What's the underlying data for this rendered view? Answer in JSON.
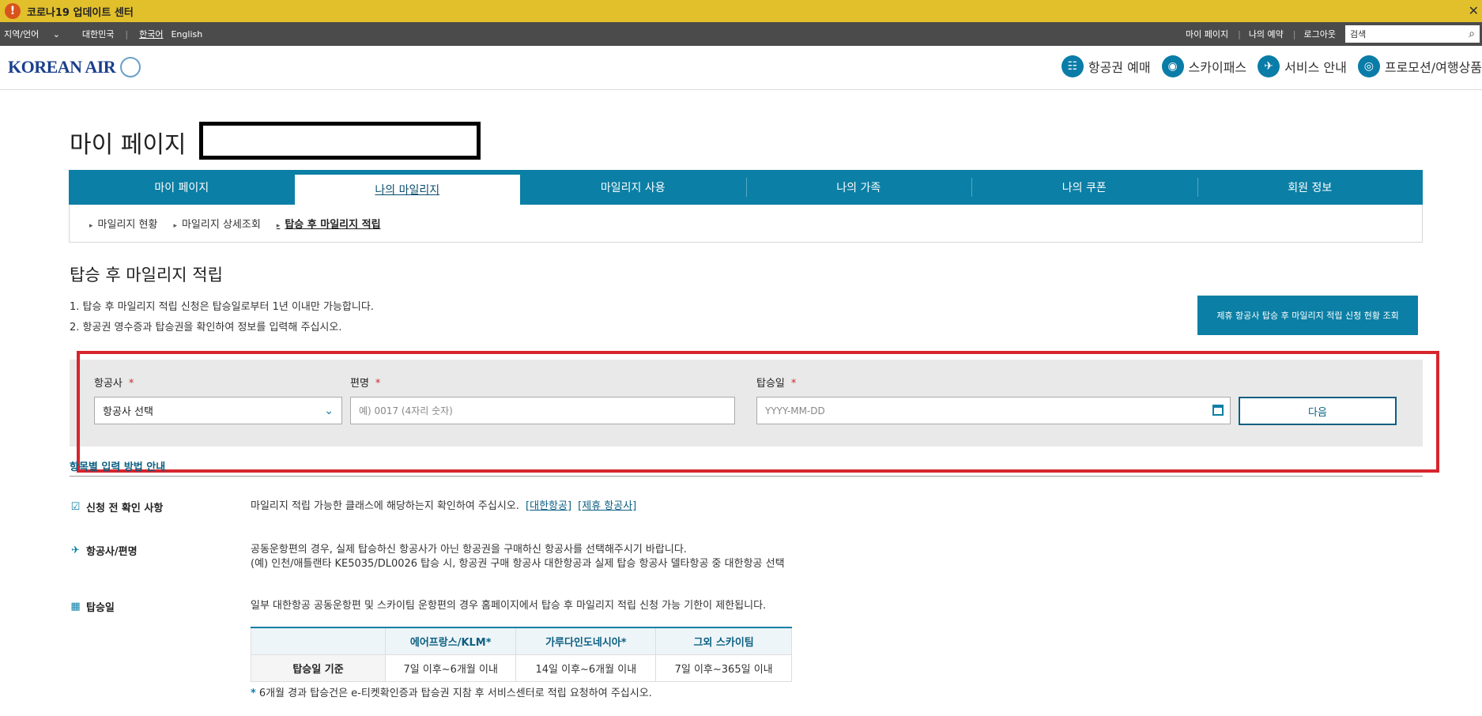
{
  "covid": {
    "icon": "!",
    "text": "코로나19 업데이트 센터",
    "close": "✕"
  },
  "util": {
    "region_lang": "지역/언어",
    "region_chevron": "⌄",
    "country": "대한민국",
    "sep": "|",
    "lang_ko": "한국어",
    "lang_en": "English",
    "my_page": "마이 페이지",
    "my_booking": "나의 예약",
    "logout": "로그아웃",
    "search_placeholder": "검색",
    "search_icon": "⌕"
  },
  "header": {
    "logo": "KOREAN AIR",
    "nav": [
      {
        "label": "항공권 예매",
        "icon": "☷"
      },
      {
        "label": "스카이패스",
        "icon": "◉"
      },
      {
        "label": "서비스 안내",
        "icon": "✈"
      },
      {
        "label": "프로모션/여행상품",
        "icon": "◎"
      }
    ]
  },
  "page": {
    "title": "마이 페이지"
  },
  "tabs": [
    {
      "label": "마이 페이지"
    },
    {
      "label": "나의 마일리지"
    },
    {
      "label": "마일리지 사용"
    },
    {
      "label": "나의 가족"
    },
    {
      "label": "나의 쿠폰"
    },
    {
      "label": "회원 정보"
    }
  ],
  "subtabs": [
    {
      "label": "마일리지 현황"
    },
    {
      "label": "마일리지 상세조회"
    },
    {
      "label": "탑승 후 마일리지 적립"
    }
  ],
  "section": {
    "title": "탑승 후 마일리지 적립",
    "notes": [
      "1.  탑승 후 마일리지 적립 신청은 탑승일로부터 1년 이내만 가능합니다.",
      "2.  항공권 영수증과 탑승권을 확인하여 정보를 입력해 주십시오."
    ],
    "status_button": "제휴 항공사 탑승 후 마일리지 적립 신청 현황 조회"
  },
  "form": {
    "airline_label": "항공사",
    "flight_label": "편명",
    "date_label": "탑승일",
    "required_mark": "*",
    "airline_value": "항공사 선택",
    "airline_chevron": "⌄",
    "flight_placeholder": "예) 0017 (4자리 숫자)",
    "date_placeholder": "YYYY-MM-DD",
    "next_button": "다음",
    "guide_link": "항목별 입력 방법 안내"
  },
  "info": {
    "check": {
      "title": "신청 전 확인 사항",
      "icon": "☑",
      "text": "마일리지 적립 가능한 클래스에 해당하는지 확인하여 주십시오.",
      "link1": "[대한항공]",
      "link2": "[제휴 항공사]"
    },
    "airline": {
      "title": "항공사/편명",
      "icon": "✈",
      "line1": "공동운항편의 경우, 실제 탑승하신 항공사가 아닌 항공권을 구매하신 항공사를 선택해주시기 바랍니다.",
      "line2": "(예) 인천/애틀랜타 KE5035/DL0026 탑승 시, 항공권 구매 항공사 대한항공과 실제 탑승 항공사 델타항공 중 대한항공 선택"
    },
    "date": {
      "title": "탑승일",
      "icon": "▦",
      "text": "일부 대한항공 공동운항편 및 스카이팀 운항편의 경우 홈페이지에서 탑승 후 마일리지 적립 신청 가능 기한이 제한됩니다."
    }
  },
  "table": {
    "headers": [
      "에어프랑스/KLM*",
      "가루다인도네시아*",
      "그외 스카이팀"
    ],
    "row_header": "탑승일 기준",
    "cells": [
      "7일 이후~6개월 이내",
      "14일 이후~6개월 이내",
      "7일 이후~365일 이내"
    ]
  },
  "footnote": {
    "mark": "*",
    "text": "6개월 경과 탑승건은 e-티켓확인증과 탑승권 지참 후 서비스센터로 적립 요청하여 주십시오."
  }
}
